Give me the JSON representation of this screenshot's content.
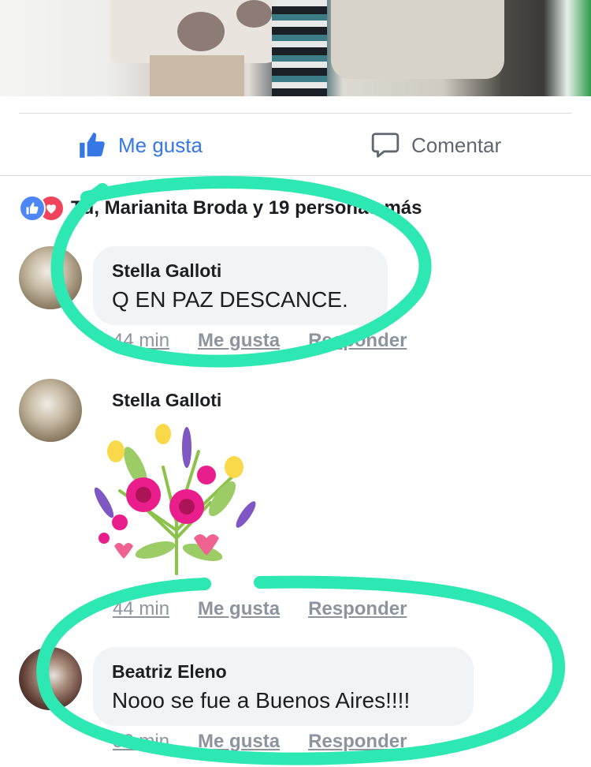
{
  "post_actions": {
    "like_label": "Me gusta",
    "comment_label": "Comentar"
  },
  "reactions": {
    "summary": "Tú, Marianita Broda y 19 personas más"
  },
  "comments": [
    {
      "author": "Stella Galloti",
      "text": "Q EN PAZ DESCANCE.",
      "time": "44 min",
      "like": "Me gusta",
      "reply": "Responder"
    },
    {
      "author": "Stella Galloti",
      "text": "",
      "time": "44 min",
      "like": "Me gusta",
      "reply": "Responder",
      "sticker": "flower-bouquet-sticker"
    },
    {
      "author": "Beatriz Eleno",
      "text": "Nooo se fue a Buenos Aires!!!!",
      "time": "38 min",
      "like": "Me gusta",
      "reply": "Responder"
    }
  ],
  "colors": {
    "facebook_blue": "#3578e5",
    "bubble_gray": "#f2f3f5",
    "annotation_teal": "#2ee8b4",
    "meta_gray": "#8d949e"
  }
}
